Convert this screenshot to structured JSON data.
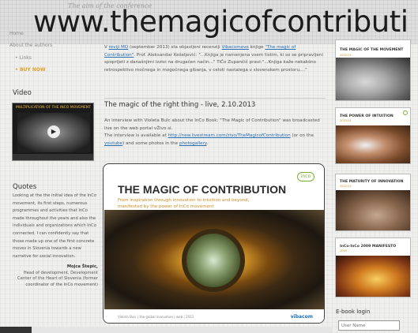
{
  "header": {
    "faded_heading": "The aim of the conference",
    "watermark": "www.themagicofcontributi"
  },
  "nav": {
    "items": [
      {
        "label": "Home",
        "highlight": false
      },
      {
        "label": "About the authors",
        "highlight": false
      },
      {
        "label": "Links",
        "highlight": false
      },
      {
        "label": "BUY NOW",
        "highlight": true
      }
    ]
  },
  "video": {
    "heading": "Video",
    "thumb_title": "MULTIPLICATION OF THE INCO MOVEMENT"
  },
  "quotes": {
    "heading": "Quotes",
    "body": "Looking at the the initial idea of the InCo movement, its first steps, numerous programmes and activities that InCo made throughout the years and also the individuals and organizations which InCo connected, I can confidently say that those made up one of the first concrete moves in Slovenia towards a new narrative for social innovation.",
    "author_name": "Mojca Štepic,",
    "author_role": "Head of development, Development Center of the Heart of Slovenia (former coordinator of the InCo movement)"
  },
  "main": {
    "review_parts": {
      "p1": "V ",
      "link1": "reviji MQ",
      "p2": " (september 2013) sta objavljeni recenziji ",
      "link2": "Vibacomove",
      "p3": " knjige ",
      "link3": "\"The magic of Contribution\"",
      "p4": ". Prof. Aleksandar Kešeljević: \"...Knjiga je namenjena vsem tistim, ki so se pripravljeni spoprijeti z današnjimi izzivi na drugačen način...\" TiČo Zupančič pravi:\"...Knjiga kaže nekakšno retrospektivo močnega in mogočnega gibanja, v celoti nastalega v slovenskem prostoru....\""
    },
    "post_title": "The magic of the right thing - live, 2.10.2013",
    "post_body": "An interview with Violeta Bulc about the InCo Book: \"The Magic of Contribution\" was broadcasted live on the web portal vŽivo si.",
    "post_link_prefix": "The interview is available at ",
    "post_link_url": "http://new.livestream.com/zivo/TheMagicofContribution",
    "post_link_mid": " (or on the ",
    "post_link_youtube": "youtube",
    "post_link_mid2": ") and some photos in the ",
    "post_link_gallery": "photogallery",
    "post_link_end": "."
  },
  "book": {
    "title": "THE MAGIC OF CONTRIBUTION",
    "subtitle_line1": "From inspiration through innovation to intuition and beyond,",
    "subtitle_line2": "manifested by the power of InCo movement",
    "logo": "inco",
    "footer": "Violeta Bulc | the global innovation | web | 2013",
    "publisher": "vibacom"
  },
  "right_cards": [
    {
      "title": "THE MAGIC OF THE MOVEMENT",
      "subtitle": "2012/13"
    },
    {
      "title": "THE POWER OF INTUITION",
      "subtitle": "2013/14"
    },
    {
      "title": "THE MATURITY OF INNOVATION",
      "subtitle": "2012/13"
    },
    {
      "title": "InCo-InCo 2009 MANIFESTO",
      "subtitle": "2009"
    }
  ],
  "ebook": {
    "heading": "E-book login",
    "username_placeholder": "User Name"
  }
}
